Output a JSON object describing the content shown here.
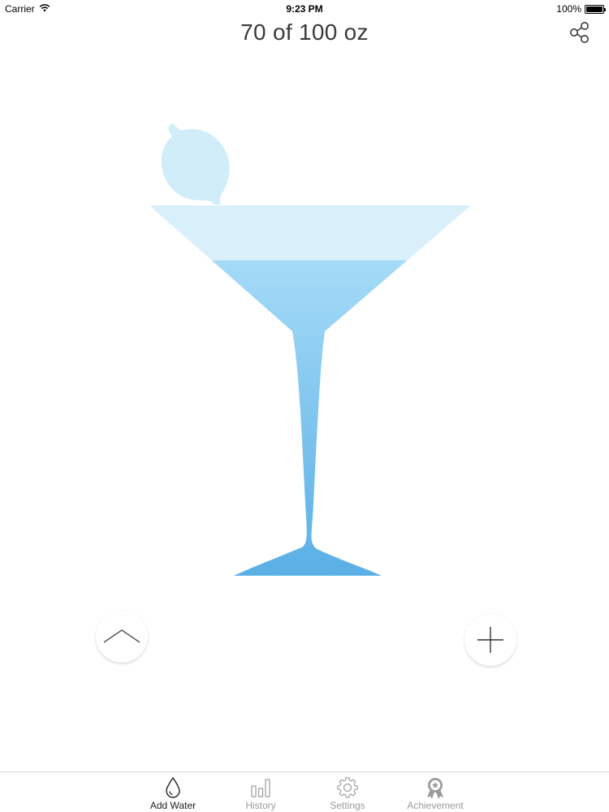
{
  "status_bar": {
    "carrier": "Carrier",
    "time": "9:23 PM",
    "battery": "100%",
    "battery_level": 1.0
  },
  "header": {
    "title": "70 of 100 oz",
    "share_icon": "share-icon"
  },
  "progress": {
    "current": 70,
    "goal": 100,
    "unit": "oz",
    "fraction": 0.7
  },
  "colors": {
    "water_top": "#a5dbf7",
    "water_bottom": "#5aafe6",
    "glass_empty": "#d9f0fb",
    "olive": "#d2edfa",
    "active_tab": "#1e1e1e",
    "inactive_tab": "#9b9b9b"
  },
  "controls": {
    "up_icon": "chevron-up-icon",
    "add_icon": "plus-icon"
  },
  "tabs": [
    {
      "label": "Add Water",
      "icon": "water-drop-icon",
      "active": true
    },
    {
      "label": "History",
      "icon": "bar-chart-icon",
      "active": false
    },
    {
      "label": "Settings",
      "icon": "gear-icon",
      "active": false
    },
    {
      "label": "Achievement",
      "icon": "award-ribbon-icon",
      "active": false
    }
  ]
}
